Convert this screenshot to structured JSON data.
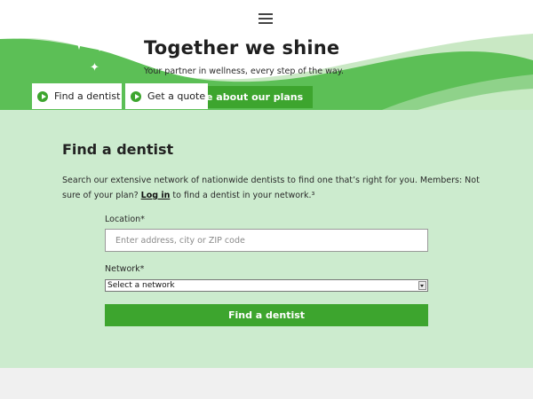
{
  "hero": {
    "title": "Together we shine",
    "subtitle": "Your partner in wellness, every step of the way.",
    "plans_button": "e about our plans"
  },
  "tabs": [
    {
      "label": "Find a dentist",
      "icon": "play-circle-icon"
    },
    {
      "label": "Get a quote",
      "icon": "play-circle-icon"
    }
  ],
  "find": {
    "heading": "Find a dentist",
    "desc_before": "Search our extensive network of nationwide dentists to find one that’s right for you. Members: Not sure of your plan? ",
    "login_link": "Log in",
    "desc_after": " to find a dentist in your network.³",
    "location_label": "Location*",
    "location_placeholder": "Enter address, city or ZIP code",
    "network_label": "Network*",
    "network_selected": "Select a network",
    "submit_label": "Find a dentist"
  },
  "colors": {
    "brand_green": "#3da52e",
    "panel_green": "#ccebce",
    "hero_green": "#5cbf56"
  }
}
